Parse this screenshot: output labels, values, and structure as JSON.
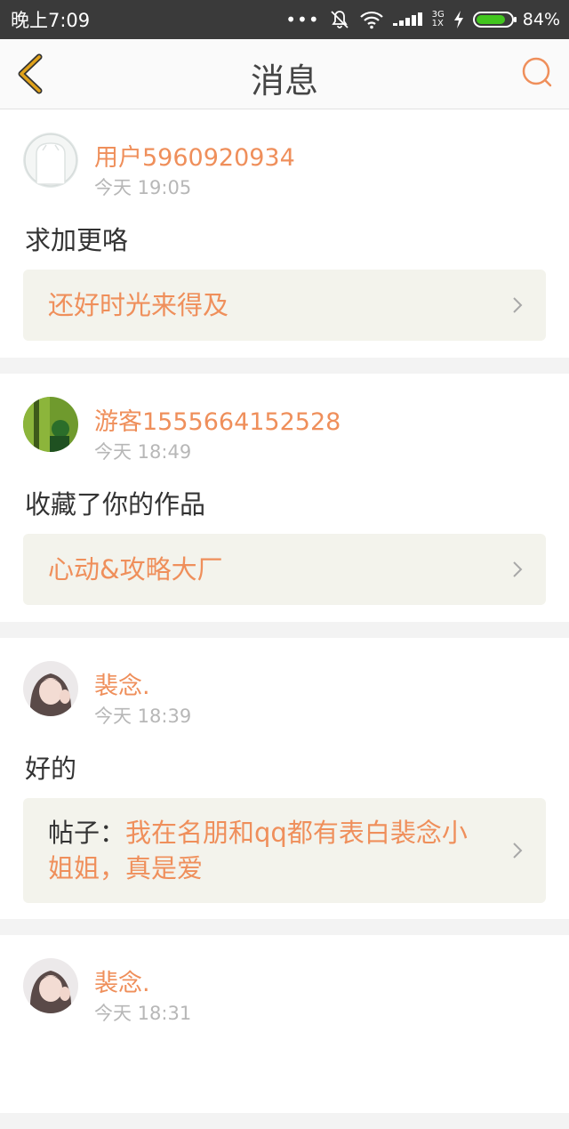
{
  "status_bar": {
    "time": "晚上7:09",
    "network_top": "3G",
    "network_bottom": "1X",
    "battery": "84%",
    "battery_level": 0.84,
    "battery_color": "#42c51e"
  },
  "header": {
    "title": "消息",
    "back_icon": "chevron-left-icon",
    "search_icon": "search-icon"
  },
  "colors": {
    "accent": "#ef8f5b",
    "back_icon": "#e0a21b"
  },
  "messages": [
    {
      "username": "用户5960920934",
      "time": "今天 19:05",
      "text": "求加更咯",
      "ref_prefix": "",
      "ref_title": "还好时光来得及"
    },
    {
      "username": "游客1555664152528",
      "time": "今天 18:49",
      "text": "收藏了你的作品",
      "ref_prefix": "",
      "ref_title": "心动&攻略大厂"
    },
    {
      "username": "裴念.",
      "time": "今天 18:39",
      "text": "好的",
      "ref_prefix": "帖子：",
      "ref_title": "我在名朋和qq都有表白裴念小姐姐，真是爱"
    },
    {
      "username": "裴念.",
      "time": "今天 18:31",
      "text": "",
      "ref_prefix": "",
      "ref_title": ""
    }
  ]
}
